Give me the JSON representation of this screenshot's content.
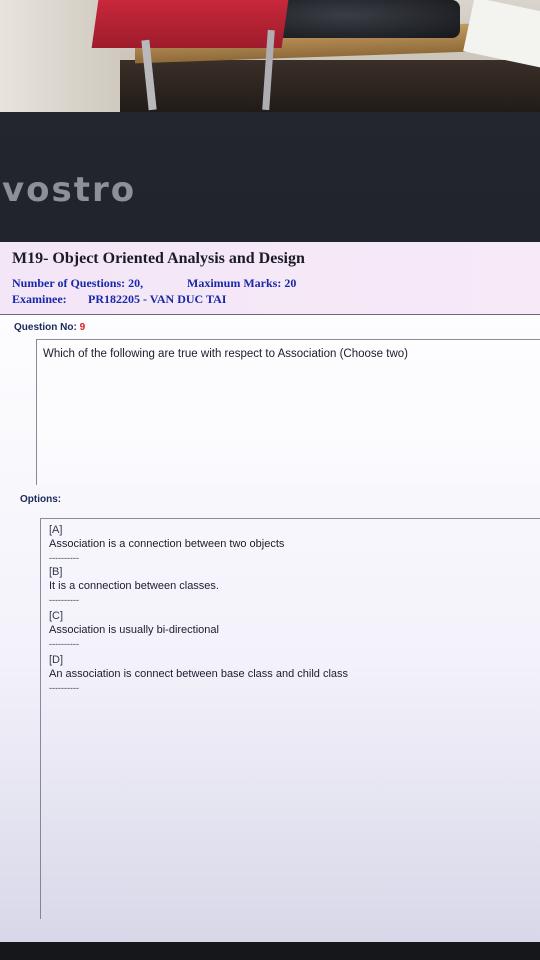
{
  "laptop": {
    "brand": "vostro"
  },
  "exam": {
    "title": "M19- Object Oriented Analysis and Design",
    "questions_label": "Number of Questions: 20,",
    "marks_label": "Maximum Marks: 20",
    "examinee_label": "Examinee:",
    "examinee_value": "PR182205 - VAN DUC TAI"
  },
  "question": {
    "label": "Question No:",
    "number": "9",
    "text": "Which of the following are true with respect to Association (Choose two)"
  },
  "options": {
    "label": "Options:",
    "separator": "----------",
    "items": [
      {
        "key": "[A]",
        "text": "Association is a connection between two objects"
      },
      {
        "key": "[B]",
        "text": "It is a connection between classes."
      },
      {
        "key": "[C]",
        "text": "Association is usually bi-directional"
      },
      {
        "key": "[D]",
        "text": "An association is connect between base class and child class"
      }
    ]
  },
  "colors": {
    "accent": "#1a27a8",
    "question_number": "#d81e1e",
    "header_bg": "#f3e6f6"
  }
}
